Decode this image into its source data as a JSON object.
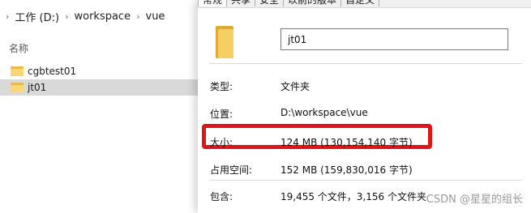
{
  "breadcrumb": [
    "工作 (D:)",
    "workspace",
    "vue"
  ],
  "explorer": {
    "column_header": "名称",
    "items": [
      {
        "name": "cgbtest01",
        "selected": false
      },
      {
        "name": "jt01",
        "selected": true
      }
    ]
  },
  "dialog": {
    "tabs": [
      {
        "label": "常规",
        "active": true
      },
      {
        "label": "共享",
        "active": false
      },
      {
        "label": "安全",
        "active": false
      },
      {
        "label": "以前的版本",
        "active": false
      },
      {
        "label": "自定义",
        "active": false
      }
    ],
    "name_value": "jt01",
    "properties": [
      {
        "label": "类型:",
        "value": "文件夹"
      },
      {
        "label": "位置:",
        "value": "D:\\workspace\\vue"
      },
      {
        "label": "大小:",
        "value": "124 MB (130,154,140 字节)"
      },
      {
        "label": "占用空间:",
        "value": "152 MB (159,830,016 字节)"
      },
      {
        "label": "包含:",
        "value": "19,455 个文件，3,156 个文件夹"
      }
    ],
    "highlight_color": "#e01515"
  },
  "watermark": "CSDN @星星的组长"
}
